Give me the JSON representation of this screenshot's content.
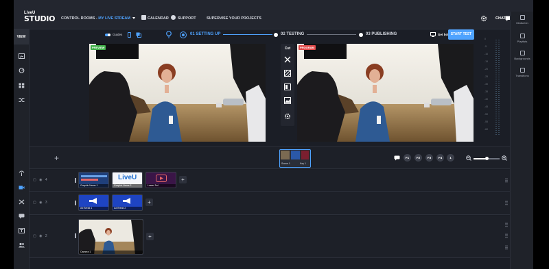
{
  "brand": {
    "line1": "LiveU",
    "line2": "STUDIO"
  },
  "nav": {
    "control_rooms": "CONTROL ROOMS - ",
    "stream_name": "MY LIVE STREAM",
    "calendar": "CALENDAR",
    "support": "SUPPORT",
    "supervise": "SUPERVISE YOUR PROJECTS",
    "chat": "CHAT"
  },
  "left_rail": {
    "view": "VIEW"
  },
  "right_rail": [
    "Media bin",
    "Playlists",
    "Backgrounds",
    "Transitions"
  ],
  "steps": {
    "guides": "Guides",
    "step1": "01  SETTING UP",
    "step2": "02  TESTING",
    "step3": "03  PUBLISHING",
    "link": "Get bolate.url",
    "start_test": "START TEST"
  },
  "monitors": {
    "preview": "PREVIEW",
    "program": "PROGRAM",
    "cut": "Cut"
  },
  "meter_labels": [
    "0",
    "-5",
    "-10",
    "-15",
    "-20",
    "-25",
    "-30",
    "-35",
    "-40",
    "-45",
    "-50",
    "-55",
    "-60"
  ],
  "scenebar": {
    "scene_name": "Scene 1",
    "scene_key": "Key 1",
    "function_buttons": [
      "F1",
      "F2",
      "F3",
      "F4",
      "1"
    ],
    "zoom_level": 0.5
  },
  "layers": [
    {
      "number": "4",
      "clips": [
        "Graphic Name 1",
        "Graphic Name 2",
        "Lower 3rd"
      ]
    },
    {
      "number": "3",
      "clips": [
        "Ad Break 1",
        "Ad Break 2"
      ]
    },
    {
      "number": "2",
      "clips": [
        "Camera 1"
      ]
    }
  ],
  "clip_text": {
    "liveu": "LiveU"
  },
  "colors": {
    "accent": "#4fa3ff",
    "preview_tag": "#41b04a",
    "program_tag": "#e04a4a",
    "background": "#1b1e26"
  }
}
